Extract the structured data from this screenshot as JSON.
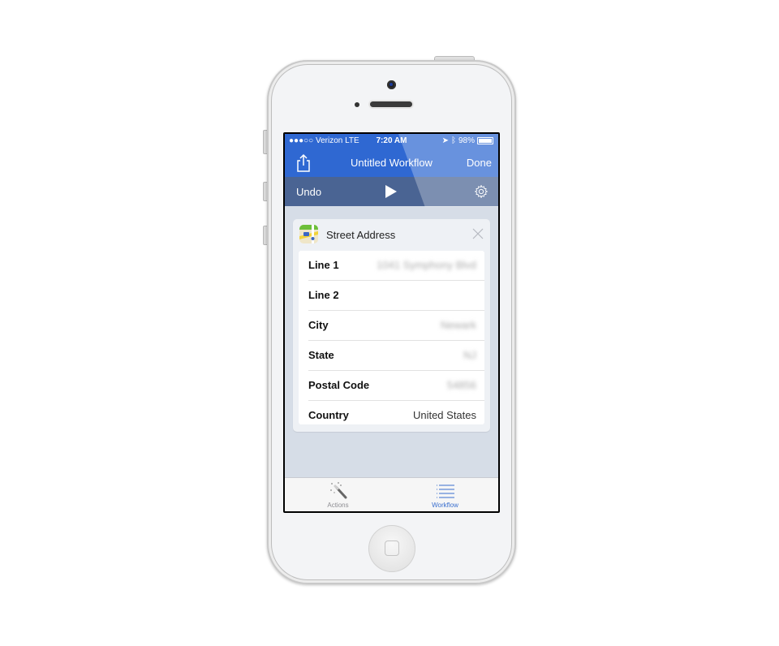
{
  "status_bar": {
    "carrier": "●●●○○ Verizon  LTE",
    "time": "7:20 AM",
    "battery": "98%"
  },
  "nav_bar": {
    "title": "Untitled Workflow",
    "done_label": "Done",
    "share_icon": "share-icon"
  },
  "toolbar": {
    "undo_label": "Undo",
    "play_icon": "play-icon",
    "settings_icon": "gear-icon"
  },
  "action_card": {
    "title": "Street Address",
    "icon": "maps-icon",
    "close_icon": "close-icon",
    "fields": [
      {
        "label": "Line 1",
        "value": "1041 Symphony Blvd",
        "blurred": true
      },
      {
        "label": "Line 2",
        "value": "",
        "blurred": false
      },
      {
        "label": "City",
        "value": "Newark",
        "blurred": true
      },
      {
        "label": "State",
        "value": "NJ",
        "blurred": true
      },
      {
        "label": "Postal Code",
        "value": "54856",
        "blurred": true
      },
      {
        "label": "Country",
        "value": "United States",
        "blurred": false
      }
    ]
  },
  "tab_bar": {
    "tabs": [
      {
        "label": "Actions",
        "icon": "magic-wand-icon",
        "active": false
      },
      {
        "label": "Workflow",
        "icon": "list-icon",
        "active": true
      }
    ]
  },
  "colors": {
    "nav_blue": "#2f68d2",
    "toolbar_slate": "#4a6493",
    "background": "#d6dde7",
    "tab_active": "#3a6fce",
    "tab_inactive": "#8e8e93"
  }
}
